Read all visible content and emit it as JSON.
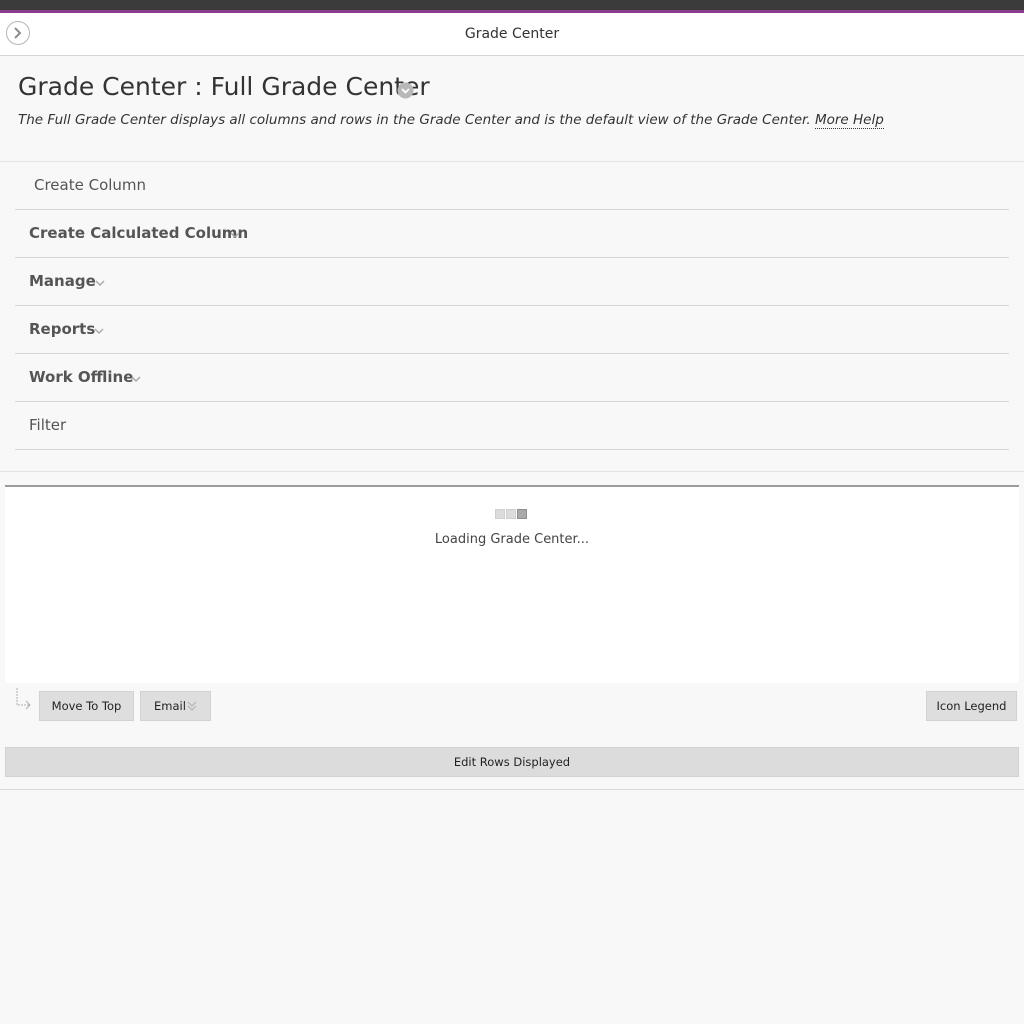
{
  "header": {
    "title": "Grade Center"
  },
  "page": {
    "title": "Grade Center : Full Grade Center",
    "description": "The Full Grade Center displays all columns and rows in the Grade Center and is the default view of the Grade Center.",
    "more_help": "More Help"
  },
  "actions": {
    "create_column": "Create Column",
    "create_calculated_column": "Create Calculated Column",
    "manage": "Manage",
    "reports": "Reports",
    "work_offline": "Work Offline",
    "filter": "Filter"
  },
  "loading": {
    "text": "Loading Grade Center..."
  },
  "buttons": {
    "move_to_top": "Move To Top",
    "email": "Email",
    "icon_legend": "Icon Legend",
    "edit_rows_displayed": "Edit Rows Displayed"
  },
  "icons": {
    "collapse": "chevron-right-icon",
    "title_menu": "circle-chevron-down-icon",
    "dropdown": "chevron-down-icon",
    "selected_rows_arrow": "corner-arrow-icon",
    "loading": "loading-indicator-icon"
  },
  "colors": {
    "top_bar": "#3b3b3b",
    "accent": "#8a3d8f",
    "button_bg": "#dedede"
  }
}
